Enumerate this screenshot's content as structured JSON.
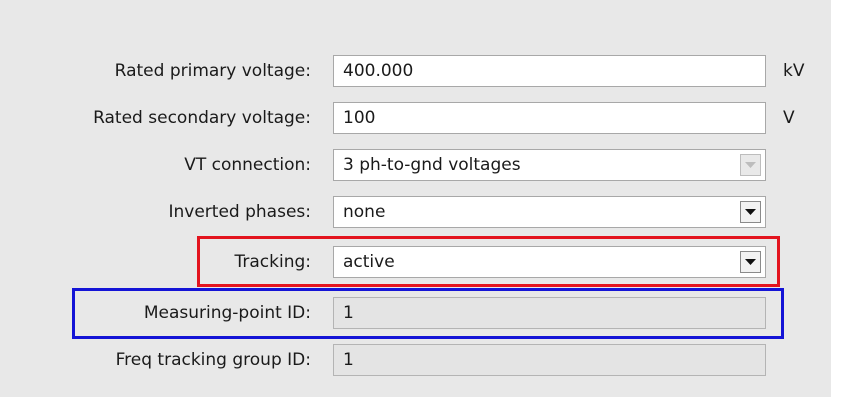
{
  "fields": [
    {
      "label": "Rated primary voltage:",
      "value": "400.000",
      "unit": "kV"
    },
    {
      "label": "Rated secondary voltage:",
      "value": "100",
      "unit": "V"
    },
    {
      "label": "VT connection:",
      "value": "3 ph-to-gnd voltages"
    },
    {
      "label": "Inverted phases:",
      "value": "none"
    },
    {
      "label": "Tracking:",
      "value": "active"
    },
    {
      "label": "Measuring-point ID:",
      "value": "1"
    },
    {
      "label": "Freq tracking group ID:",
      "value": "1"
    }
  ],
  "highlights": {
    "tracking_color": "#e3141e",
    "measuring_point_color": "#1414d6"
  },
  "icons": {
    "dropdown": "chevron-down-icon"
  }
}
